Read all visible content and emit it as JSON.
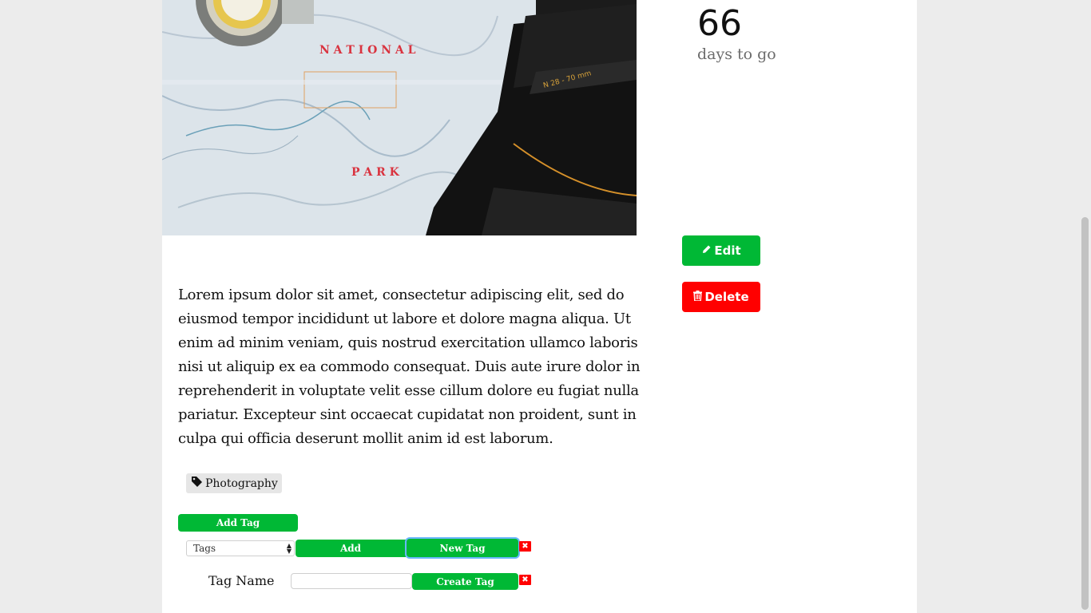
{
  "hero": {
    "map_text_1": "N A T I O N A L",
    "map_text_2": "P A R K"
  },
  "countdown": {
    "value": "66",
    "label": "days to go"
  },
  "actions": {
    "edit_label": "Edit",
    "delete_label": "Delete"
  },
  "description": "Lorem ipsum dolor sit amet, consectetur adipiscing elit, sed do eiusmod tempor incididunt ut labore et dolore magna aliqua. Ut enim ad minim veniam, quis nostrud exercitation ullamco laboris nisi ut aliquip ex ea commodo consequat. Duis aute irure dolor in reprehenderit in voluptate velit esse cillum dolore eu fugiat nulla pariatur. Excepteur sint occaecat cupidatat non proident, sunt in culpa qui officia deserunt mollit anim id est laborum.",
  "tags": {
    "items": [
      "Photography"
    ]
  },
  "tag_form": {
    "add_tag_label": "Add Tag",
    "select_value": "Tags",
    "add_label": "Add",
    "new_tag_label": "New Tag",
    "remove_symbol": "✖",
    "tag_name_label": "Tag Name",
    "tag_name_value": "",
    "create_tag_label": "Create Tag"
  },
  "colors": {
    "accent": "#00b835",
    "danger": "#ff0000"
  }
}
